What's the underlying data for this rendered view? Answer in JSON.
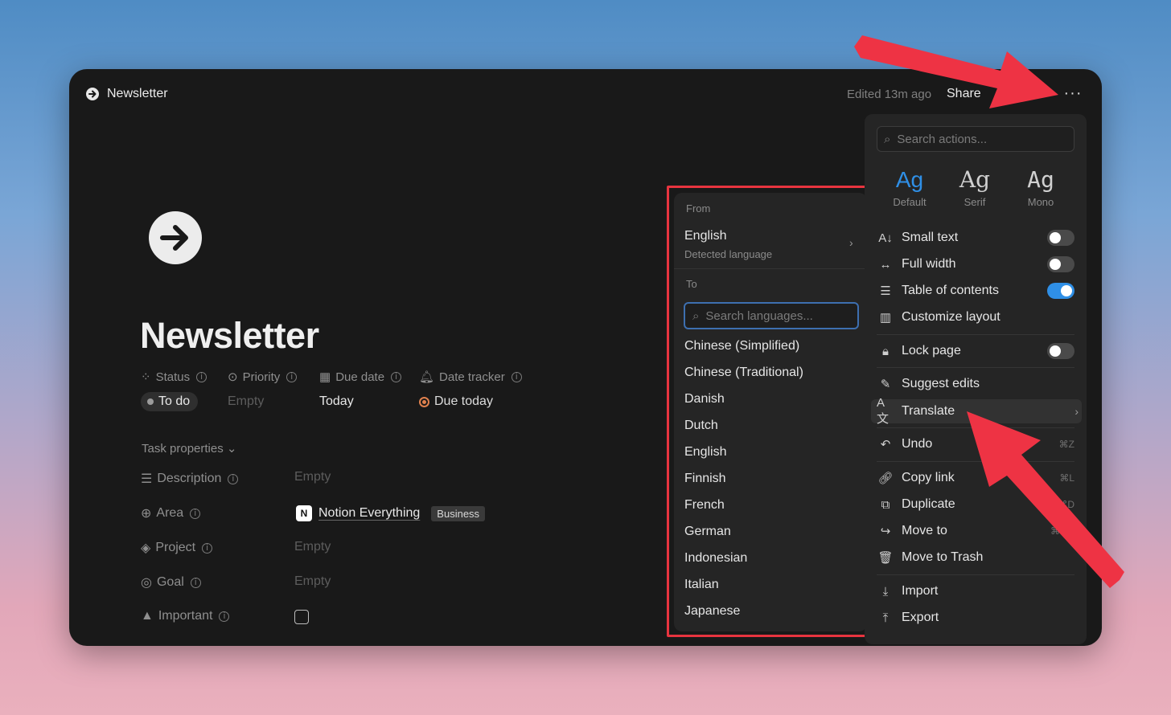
{
  "topbar": {
    "breadcrumb_title": "Newsletter",
    "edited": "Edited 13m ago",
    "share": "Share",
    "more": "···"
  },
  "page": {
    "title": "Newsletter",
    "properties": [
      {
        "label": "Status",
        "icon": "status-icon"
      },
      {
        "label": "Priority",
        "icon": "priority-icon"
      },
      {
        "label": "Due date",
        "icon": "calendar-icon"
      },
      {
        "label": "Date tracker",
        "icon": "bell-icon"
      }
    ],
    "values": {
      "status": "To do",
      "priority": "Empty",
      "due_date": "Today",
      "date_tracker": "Due today"
    },
    "task_properties_label": "Task properties",
    "rows": [
      {
        "label": "Description",
        "value": "Empty"
      },
      {
        "label": "Area",
        "value": "Notion Everything",
        "tag": "Business"
      },
      {
        "label": "Project",
        "value": "Empty"
      },
      {
        "label": "Goal",
        "value": "Empty"
      },
      {
        "label": "Important",
        "value": ""
      }
    ]
  },
  "translate_menu": {
    "from_label": "From",
    "from_value": "English",
    "from_sub": "Detected language",
    "to_label": "To",
    "search_placeholder": "Search languages...",
    "languages": [
      "Chinese (Simplified)",
      "Chinese (Traditional)",
      "Danish",
      "Dutch",
      "English",
      "Finnish",
      "French",
      "German",
      "Indonesian",
      "Italian",
      "Japanese"
    ]
  },
  "actions_menu": {
    "search_placeholder": "Search actions...",
    "fonts": [
      {
        "sample": "Ag",
        "name": "Default",
        "selected": true
      },
      {
        "sample": "Ag",
        "name": "Serif",
        "selected": false
      },
      {
        "sample": "Ag",
        "name": "Mono",
        "selected": false
      }
    ],
    "items": {
      "small_text": "Small text",
      "full_width": "Full width",
      "toc": "Table of contents",
      "customize": "Customize layout",
      "lock": "Lock page",
      "suggest": "Suggest edits",
      "translate": "Translate",
      "undo": "Undo",
      "undo_sc": "⌘Z",
      "copy_link": "Copy link",
      "copy_sc": "⌘L",
      "duplicate": "Duplicate",
      "dup_sc": "⌘D",
      "move_to": "Move to",
      "move_sc": "⌘⇧P",
      "trash": "Move to Trash",
      "import": "Import",
      "export": "Export"
    },
    "toggles": {
      "small_text": false,
      "full_width": false,
      "toc": true,
      "lock": false
    }
  },
  "colors": {
    "accent": "#2f8fe6",
    "annotation_red": "#e8343f"
  }
}
